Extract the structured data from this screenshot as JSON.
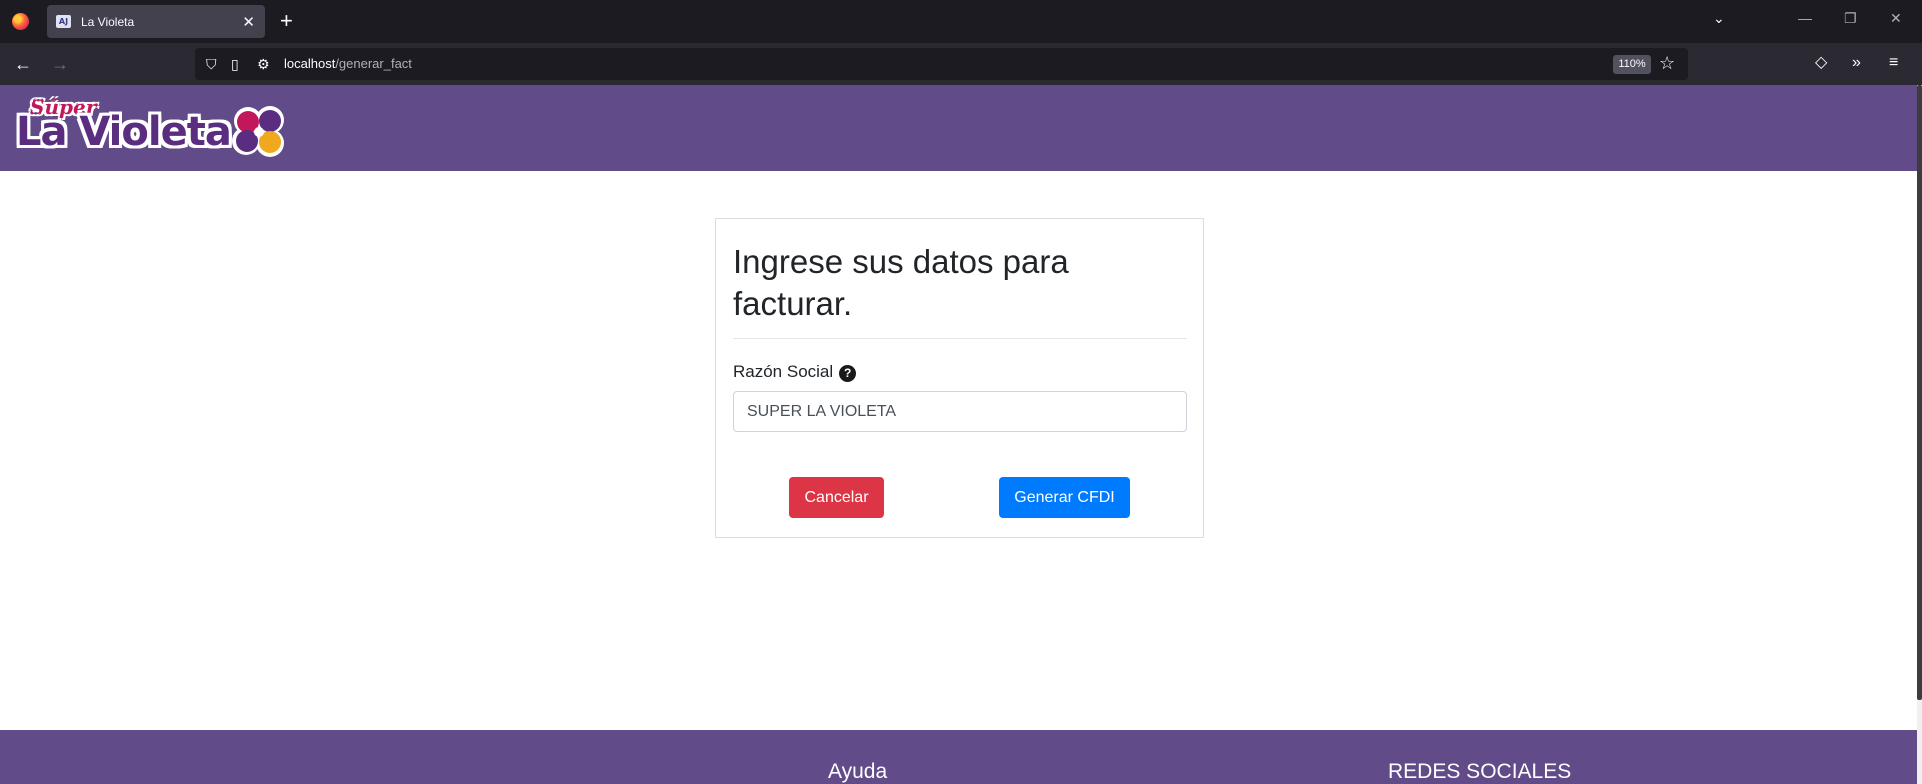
{
  "browser": {
    "tab_title": "La Violeta",
    "favicon_text": "AJ",
    "close_tab_glyph": "✕",
    "new_tab_glyph": "+",
    "tab_list_glyph": "⌄",
    "minimize_glyph": "—",
    "restore_glyph": "❐",
    "close_window_glyph": "✕",
    "back_glyph": "←",
    "forward_glyph": "→",
    "url_host": "localhost",
    "url_path": "/generar_fact",
    "zoom": "110%",
    "star_glyph": "☆",
    "overflow_glyph": "»",
    "menu_glyph": "≡",
    "pocket_glyph": "◇",
    "shield_glyph": "⛉",
    "page_glyph": "▯",
    "permissions_glyph": "⚙"
  },
  "header": {
    "logo_super": "Súper",
    "logo_name": "La Violeta"
  },
  "form": {
    "title": "Ingrese sus datos para facturar.",
    "razon_social_label": "Razón Social",
    "help_glyph": "?",
    "razon_social_value": "SUPER LA VIOLETA",
    "cancel_label": "Cancelar",
    "generate_label": "Generar CFDI"
  },
  "footer": {
    "help_heading": "Ayuda",
    "social_heading": "REDES SOCIALES"
  },
  "colors": {
    "brand_purple": "#614c89",
    "cancel_red": "#dc3545",
    "primary_blue": "#007bff",
    "logo_magenta": "#c2185b",
    "logo_orange": "#f0a81c"
  }
}
